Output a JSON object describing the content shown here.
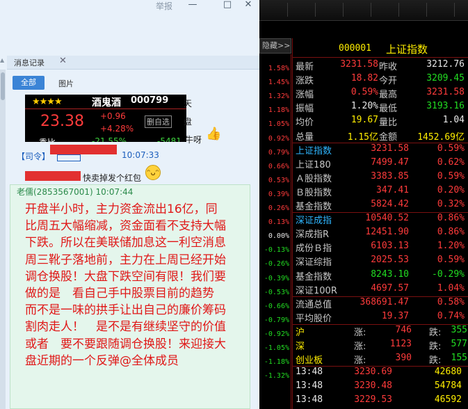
{
  "chat": {
    "report": "举报",
    "tab_label": "消息记录",
    "tab_close": "✕",
    "filter_all": "全部",
    "filter_pic": "图片",
    "stock_card": {
      "stars": "★★★★",
      "name": "酒鬼酒",
      "code": "000799",
      "price": "23.38",
      "change": "+0.96",
      "pct": "+4.28%",
      "delete_label": "删自选",
      "bottom_left": "委比",
      "bottom_mid": "-21.55%",
      "bottom_right": "-5481",
      "side_text_1": "天",
      "side_text_2": "盘",
      "tail_text": "牛呀"
    },
    "msg1": {
      "sender": "【司令】",
      "time": "10:07:33"
    },
    "msg2": {
      "text": "快卖掉发个红包"
    },
    "bubble": {
      "sender": "老儒(2853567001) 10:07:44",
      "text": "开盘半小时，主力资金流出16亿，同比周五大幅缩减，资金面看不支持大幅下跌。所以在美联储加息这一利空消息周三靴子落地前，主力在上周已经开始调仓换股！大盘下跌空间有限！我们要做的是　看自己手中股票目前的趋势　　而不是一味的拱手让出自己的廉价筹码　割肉走人！　是不是有继续坚守的价值　或者　要不要跟随调仓换股！来迎接大盘近期的一个反弹@全体成员"
    }
  },
  "quote": {
    "hide_label": "隐藏>>",
    "code": "000001",
    "name": "上证指数",
    "axis": [
      {
        "v": "1.58%",
        "c": "#ff3b3b"
      },
      {
        "v": "1.45%",
        "c": "#ff3b3b"
      },
      {
        "v": "1.32%",
        "c": "#ff3b3b"
      },
      {
        "v": "1.18%",
        "c": "#ff3b3b"
      },
      {
        "v": "1.05%",
        "c": "#ff3b3b"
      },
      {
        "v": "0.92%",
        "c": "#ff3b3b"
      },
      {
        "v": "0.79%",
        "c": "#ff3b3b"
      },
      {
        "v": "0.66%",
        "c": "#ff3b3b"
      },
      {
        "v": "0.53%",
        "c": "#ff3b3b"
      },
      {
        "v": "0.39%",
        "c": "#ff3b3b"
      },
      {
        "v": "0.26%",
        "c": "#ff3b3b"
      },
      {
        "v": "0.13%",
        "c": "#ff3b3b"
      },
      {
        "v": "0.00%",
        "c": "#e8e8e8"
      },
      {
        "v": "-0.13%",
        "c": "#22dd22"
      },
      {
        "v": "-0.26%",
        "c": "#22dd22"
      },
      {
        "v": "-0.39%",
        "c": "#22dd22"
      },
      {
        "v": "-0.53%",
        "c": "#22dd22"
      },
      {
        "v": "-0.66%",
        "c": "#22dd22"
      },
      {
        "v": "-0.79%",
        "c": "#22dd22"
      },
      {
        "v": "-0.92%",
        "c": "#22dd22"
      },
      {
        "v": "-1.05%",
        "c": "#22dd22"
      },
      {
        "v": "-1.18%",
        "c": "#22dd22"
      },
      {
        "v": "-1.32%",
        "c": "#22dd22"
      }
    ],
    "summary": [
      {
        "l1": "最新",
        "v1": "3231.58",
        "c1": "red",
        "l2": "昨收",
        "v2": "3212.76",
        "c2": "wht"
      },
      {
        "l1": "涨跌",
        "v1": "18.82",
        "c1": "red",
        "l2": "今开",
        "v2": "3209.45",
        "c2": "grn"
      },
      {
        "l1": "涨幅",
        "v1": "0.59%",
        "c1": "red",
        "l2": "最高",
        "v2": "3231.58",
        "c2": "red"
      },
      {
        "l1": "振幅",
        "v1": "1.20%",
        "c1": "wht",
        "l2": "最低",
        "v2": "3193.16",
        "c2": "grn"
      },
      {
        "l1": "均价",
        "v1": "19.67",
        "c1": "yel",
        "l2": "量比",
        "v2": "1.04",
        "c2": "wht"
      },
      {
        "l1": "总量",
        "v1": "1.15亿",
        "c1": "yel",
        "l2": "金额",
        "v2": "1452.69亿",
        "c2": "yel"
      }
    ],
    "indices": [
      {
        "name": "上证指数",
        "cyan": true,
        "value": "3231.58",
        "vc": "red",
        "pct": "0.59%",
        "pc": "red"
      },
      {
        "name": "上证180",
        "cyan": false,
        "value": "7499.47",
        "vc": "red",
        "pct": "0.62%",
        "pc": "red"
      },
      {
        "name": "Ａ股指数",
        "cyan": false,
        "value": "3383.85",
        "vc": "red",
        "pct": "0.59%",
        "pc": "red"
      },
      {
        "name": "Ｂ股指数",
        "cyan": false,
        "value": "347.41",
        "vc": "red",
        "pct": "0.20%",
        "pc": "red"
      },
      {
        "name": "基金指数",
        "cyan": false,
        "value": "5824.42",
        "vc": "red",
        "pct": "0.32%",
        "pc": "red"
      },
      {
        "name": "深证成指",
        "cyan": true,
        "value": "10540.52",
        "vc": "red",
        "pct": "0.86%",
        "pc": "red"
      },
      {
        "name": "深成指R",
        "cyan": false,
        "value": "12451.90",
        "vc": "red",
        "pct": "0.86%",
        "pc": "red"
      },
      {
        "name": "成份Ｂ指",
        "cyan": false,
        "value": "6103.13",
        "vc": "red",
        "pct": "1.20%",
        "pc": "red"
      },
      {
        "name": "深证综指",
        "cyan": false,
        "value": "2025.53",
        "vc": "red",
        "pct": "0.59%",
        "pc": "red"
      },
      {
        "name": "基金指数",
        "cyan": false,
        "value": "8243.10",
        "vc": "grn",
        "pct": "-0.29%",
        "pc": "grn"
      },
      {
        "name": "深证100R",
        "cyan": false,
        "value": "4697.57",
        "vc": "red",
        "pct": "1.04%",
        "pc": "red"
      }
    ],
    "totals": [
      {
        "name": "流通总值",
        "value": "368691.47",
        "pct": "0.58%"
      },
      {
        "name": "平均股价",
        "value": "19.37",
        "pct": "0.74%"
      }
    ],
    "breadth": [
      {
        "name": "沪",
        "up_label": "涨:",
        "up": "746",
        "down_label": "跌:",
        "down": "355"
      },
      {
        "name": "深",
        "up_label": "涨:",
        "up": "1123",
        "down_label": "跌:",
        "down": "577"
      },
      {
        "name": "创业板",
        "up_label": "涨:",
        "up": "390",
        "down_label": "跌:",
        "down": "155"
      }
    ],
    "ticks": [
      {
        "time": "13:48",
        "price": "3230.69",
        "vol": "42680"
      },
      {
        "time": "13:48",
        "price": "3230.48",
        "vol": "54784"
      },
      {
        "time": "13:48",
        "price": "3229.53",
        "vol": "46592"
      }
    ]
  }
}
